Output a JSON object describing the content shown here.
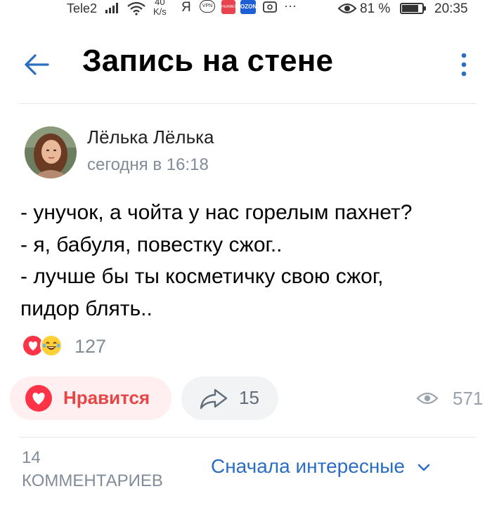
{
  "status_bar": {
    "carrier": "Tele2",
    "speed_value": "40",
    "speed_unit": "K/s",
    "ya": "Я",
    "vpn": "VPN",
    "app1": "HUAWEI",
    "app2": "OZON",
    "more": "···",
    "battery_percent": "81 %",
    "battery_level": 0.81,
    "time": "20:35"
  },
  "header": {
    "title": "Запись на стене",
    "back_icon": "arrow-left-icon",
    "menu_icon": "more-vertical-icon",
    "accent_color": "#2a6dc4"
  },
  "post": {
    "author": "Лёлька Лёлька",
    "time": "сегодня в 16:18",
    "lines": [
      "- унучок, а чойта у нас горелым пахнет?",
      "- я, бабуля, повестку сжог..",
      "- лучше бы ты косметичку свою сжог,",
      "пидор блять.."
    ],
    "reactions_count": "127",
    "reaction_icons": [
      "heart-icon",
      "laughing-emoji-icon"
    ]
  },
  "actions": {
    "like_label": "Нравится",
    "like_color": "#ff3347",
    "share_count": "15",
    "views_count": "571"
  },
  "comments": {
    "count": "14",
    "label": "КОММЕНТАРИЕВ",
    "sort_label": "Сначала интересные"
  }
}
